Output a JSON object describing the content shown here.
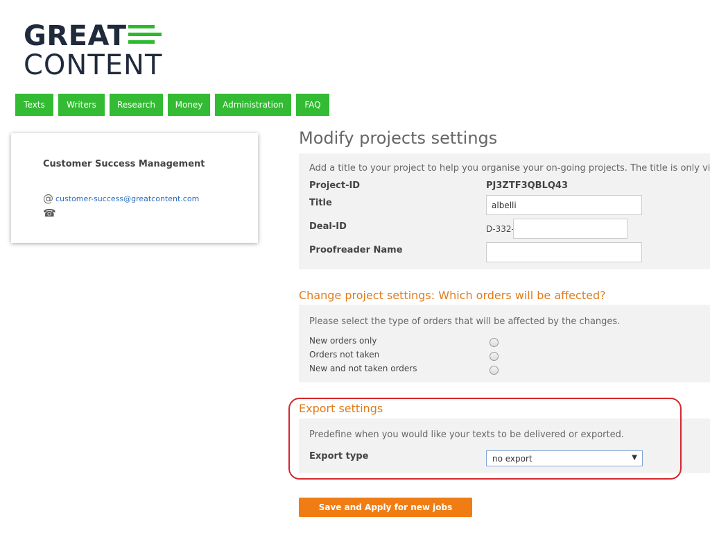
{
  "logo": {
    "line1": "GREAT",
    "line2": "CONTENT",
    "brand_color": "#2db92d"
  },
  "nav": {
    "items": [
      {
        "label": "Texts"
      },
      {
        "label": "Writers"
      },
      {
        "label": "Research"
      },
      {
        "label": "Money"
      },
      {
        "label": "Administration"
      },
      {
        "label": "FAQ"
      }
    ]
  },
  "contact": {
    "title": "Customer Success Management",
    "email_icon": "at-icon",
    "email": "customer-success@greatcontent.com",
    "phone_icon": "phone-icon"
  },
  "page": {
    "title": "Modify projects settings"
  },
  "project": {
    "intro": "Add a title to your project to help you organise your on-going projects. The title is only visible",
    "project_id_label": "Project-ID",
    "project_id_value": "PJ3ZTF3QBLQ43",
    "title_label": "Title",
    "title_value": "albelli",
    "deal_id_label": "Deal-ID",
    "deal_id_prefix": "D-332-",
    "deal_id_value": "",
    "proofreader_label": "Proofreader Name",
    "proofreader_value": ""
  },
  "change_settings": {
    "heading": "Change project settings: Which orders will be affected?",
    "intro": "Please select the type of orders that will be affected by the changes.",
    "options": [
      {
        "label": "New orders only"
      },
      {
        "label": "Orders not taken"
      },
      {
        "label": "New and not taken orders"
      }
    ]
  },
  "export": {
    "heading": "Export settings",
    "intro": "Predefine when you would like your texts to be delivered or exported.",
    "type_label": "Export type",
    "type_value": "no export",
    "arrow": "▼"
  },
  "save_button": {
    "label": "Save and Apply for new jobs"
  },
  "colors": {
    "nav_green": "#33bb33",
    "accent_orange": "#e07b1a",
    "button_orange": "#f07d14",
    "highlight_red": "#d6262e"
  }
}
